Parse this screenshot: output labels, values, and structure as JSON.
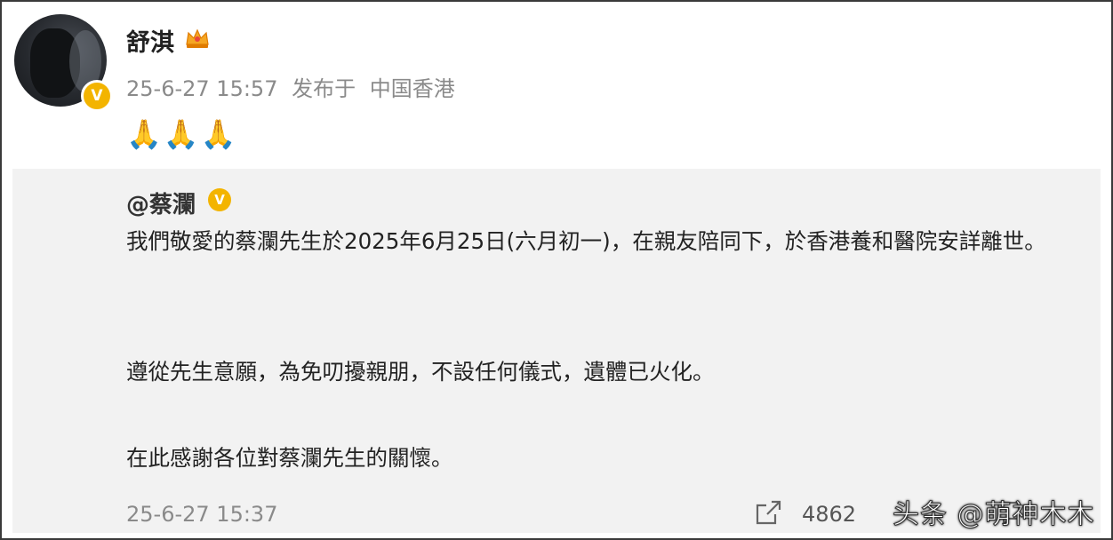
{
  "post": {
    "author": "舒淇",
    "timestamp": "25-6-27 15:57",
    "location_prefix": "发布于",
    "location": "中国香港",
    "content": "🙏🙏🙏"
  },
  "repost": {
    "author": "@蔡瀾",
    "paragraphs": [
      "我們敬愛的蔡瀾先生於2025年6月25日(六月初一)，在親友陪同下，於香港養和醫院安詳離世。",
      "遵從先生意願，為免叨擾親朋，不設任何儀式，遺體已火化。",
      "在此感謝各位對蔡瀾先生的關懷。"
    ],
    "timestamp": "25-6-27 15:37",
    "share_count": "4862"
  },
  "badges": {
    "verified_symbol": "V"
  },
  "icons": [
    "member-crown-icon",
    "verified-badge-icon",
    "share-icon",
    "comment-icon"
  ],
  "colors": {
    "verified": "#f3b400",
    "meta_text": "#8a8a8a",
    "repost_bg": "#f2f2f2"
  },
  "watermark": "头条 @萌神木木"
}
